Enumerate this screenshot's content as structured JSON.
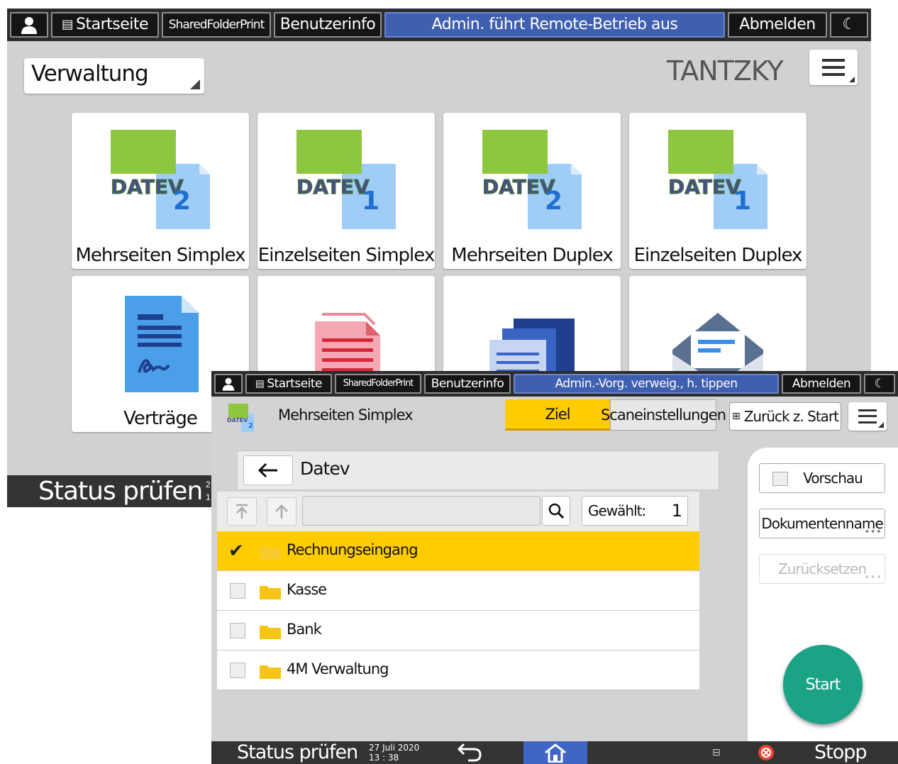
{
  "screen1": {
    "topbar": {
      "startseite": "Startseite",
      "sharedfolder": "SharedFolderPrint",
      "benutzerinfo": "Benutzerinfo",
      "message": "Admin. führt Remote-Betrieb aus",
      "abmelden": "Abmelden"
    },
    "function_select": "Verwaltung",
    "user_name": "TANTZKY",
    "tiles": [
      {
        "label": "Mehrseiten Simplex",
        "badge": "2",
        "icon": "datev-icon"
      },
      {
        "label": "Einzelseiten Simplex",
        "badge": "1",
        "icon": "datev-icon"
      },
      {
        "label": "Mehrseiten Duplex",
        "badge": "2",
        "icon": "datev-icon"
      },
      {
        "label": "Einzelseiten Duplex",
        "badge": "1",
        "icon": "datev-icon"
      },
      {
        "label": "Verträge",
        "icon": "contract-document-icon"
      },
      {
        "label": "",
        "icon": "red-document-icon"
      },
      {
        "label": "",
        "icon": "blue-documents-icon"
      },
      {
        "label": "",
        "icon": "envelope-icon"
      }
    ],
    "datev_text": "DATEV",
    "status": {
      "label": "Status prüfen",
      "date_fragment": "2\n1"
    }
  },
  "screen2": {
    "topbar": {
      "startseite": "Startseite",
      "sharedfolder": "SharedFolderPrint",
      "benutzerinfo": "Benutzerinfo",
      "message": "Admin.-Vorg. verweig., h. tippen",
      "abmelden": "Abmelden"
    },
    "scan_title": "Mehrseiten Simplex",
    "tabs": {
      "ziel": "Ziel",
      "scaneinstellungen": "Scaneinstellungen"
    },
    "back_to_start": "Zurück z. Start",
    "breadcrumb": "Datev",
    "search": {
      "value": "",
      "placeholder": ""
    },
    "selected": {
      "label": "Gewählt:",
      "count": "1"
    },
    "folders": [
      {
        "name": "Rechnungseingang",
        "selected": true
      },
      {
        "name": "Kasse",
        "selected": false
      },
      {
        "name": "Bank",
        "selected": false
      },
      {
        "name": "4M Verwaltung",
        "selected": false
      }
    ],
    "side": {
      "vorschau": "Vorschau",
      "dokumentenname": "Dokumentenname",
      "zuruecksetzen": "Zurücksetzen",
      "start": "Start"
    },
    "status": {
      "label": "Status prüfen",
      "date": "27 Juli 2020",
      "time": "13 : 38",
      "stopp": "Stopp"
    }
  },
  "colors": {
    "topbar_bg": "#2c2c2e",
    "message_bg": "#3f5fb0",
    "selected_row": "#ffcc00",
    "start_button": "#1aa385",
    "home_button": "#3f66c4",
    "datev_green": "#8dc63f",
    "datev_blue": "#1f6fd1"
  }
}
